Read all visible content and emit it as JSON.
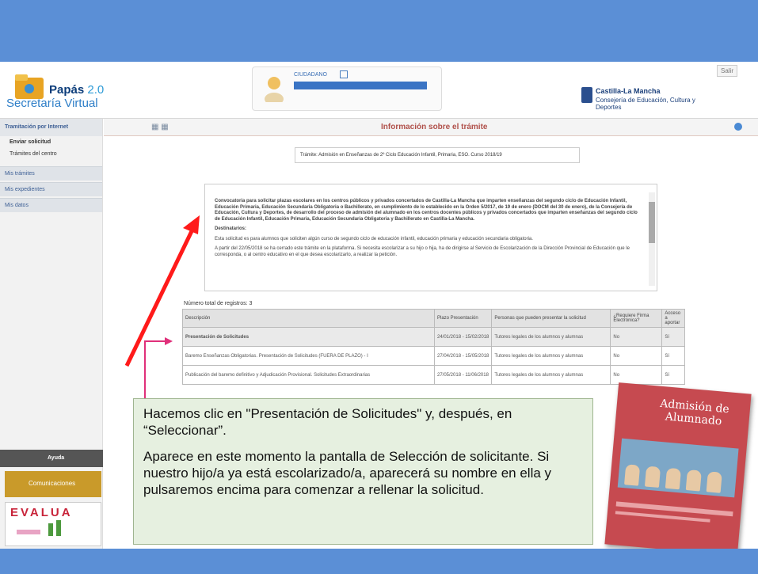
{
  "app": {
    "name": "Papás",
    "version": "2.0",
    "subtitle": "Secretaría Virtual",
    "user_label": "CIUDADANO",
    "logout": "Salir",
    "region_title": "Castilla-La Mancha",
    "region_sub": "Consejería de Educación, Cultura y Deportes"
  },
  "sidebar": {
    "section": "Tramitación por Internet",
    "items": [
      "Enviar solicitud",
      "Trámites del centro"
    ],
    "groups": [
      "Mis trámites",
      "Mis expedientes",
      "Mis datos"
    ],
    "help": "Ayuda",
    "comms": "Comunicaciones",
    "evalua": "EVALUA"
  },
  "main": {
    "title": "Información sobre el trámite",
    "tramite": "Trámite: Admisión en Enseñanzas de 2º Ciclo Educación Infantil, Primaria, ESO. Curso 2018/19",
    "info": [
      "Convocatoria para solicitar plazas escolares en los centros públicos y privados concertados de Castilla-La Mancha que imparten enseñanzas del segundo ciclo de Educación Infantil, Educación Primaria, Educación Secundaria Obligatoria o Bachillerato, en cumplimiento de lo establecido en la Orden 5/2017, de 19 de enero (DOCM del 30 de enero), de la Consejería de Educación, Cultura y Deportes, de desarrollo del proceso de admisión del alumnado en los centros docentes públicos y privados concertados que imparten enseñanzas del segundo ciclo de Educación Infantil, Educación Primaria, Educación Secundaria Obligatoria y Bachillerato en Castilla-La Mancha.",
      "Destinatarios:",
      "Esta solicitud es para alumnos que soliciten algún curso de segundo ciclo de educación infantil, educación primaria y educación secundaria obligatoria.",
      "A partir del 22/05/2018 se ha cerrado este trámite en la plataforma. Si necesita escolarizar a su hijo o hija, ha de dirigirse al Servicio de Escolarización de la Dirección Provincial de Educación que le corresponda, o al centro educativo en el que desea escolarizarlo, a realizar la petición."
    ],
    "count_label": "Número total de registros: 3",
    "columns": [
      "Descripción",
      "Plazo Presentación",
      "Personas que pueden presentar la solicitud",
      "¿Requiere Firma Electrónica?",
      "Acceso a aportar"
    ],
    "rows": [
      [
        "Presentación de Solicitudes",
        "24/01/2018 - 15/02/2018",
        "Tutores legales de los alumnos y alumnas",
        "No",
        "Sí"
      ],
      [
        "Baremo Enseñanzas Obligatorias. Presentación de Solicitudes (FUERA DE PLAZO) - I",
        "27/04/2018 - 15/05/2018",
        "Tutores legales de los alumnos y alumnas",
        "No",
        "Sí"
      ],
      [
        "Publicación del baremo definitivo y Adjudicación Provisional. Solicitudes Extraordinarias",
        "27/05/2018 - 11/06/2018",
        "Tutores legales de los alumnos y alumnas",
        "No",
        "Sí"
      ]
    ]
  },
  "callout": {
    "p1": "Hacemos clic en \"Presentación de Solicitudes\" y, después, en “Seleccionar”.",
    "p2": "Aparece en este momento la pantalla de Selección de solicitante. Si nuestro hijo/a ya está escolarizado/a, aparecerá su nombre en ella y pulsaremos encima para comenzar a rellenar la solicitud."
  },
  "book": {
    "title": "Admisión de Alumnado"
  },
  "colors": {
    "band": "#5b8fd6",
    "arrow": "#ff1a1a",
    "pointer": "#e0307a",
    "callout_bg": "#e6f0e0"
  }
}
